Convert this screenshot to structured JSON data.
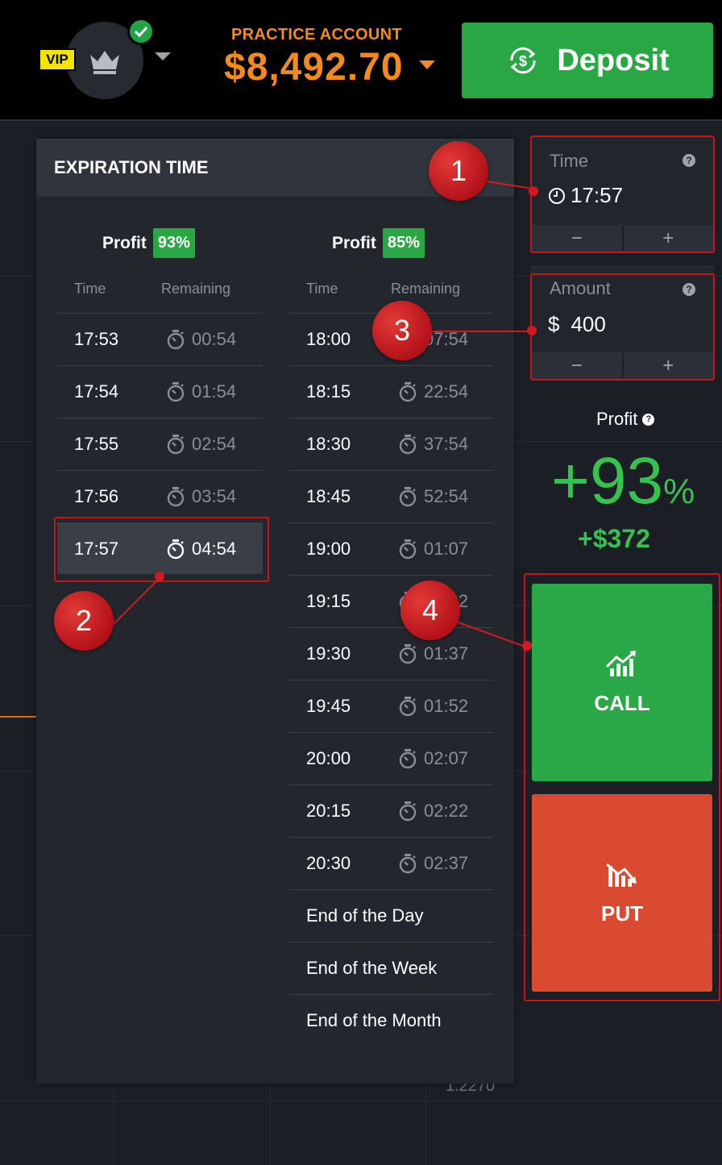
{
  "header": {
    "vip_label": "VIP",
    "account_label": "PRACTICE ACCOUNT",
    "balance": "$8,492.70",
    "deposit_label": "Deposit"
  },
  "expiration": {
    "title": "EXPIRATION TIME",
    "profit_label": "Profit",
    "col_time": "Time",
    "col_remaining": "Remaining",
    "left": {
      "profit": "93%",
      "rows": [
        {
          "time": "17:53",
          "remaining": "00:54"
        },
        {
          "time": "17:54",
          "remaining": "01:54"
        },
        {
          "time": "17:55",
          "remaining": "02:54"
        },
        {
          "time": "17:56",
          "remaining": "03:54"
        },
        {
          "time": "17:57",
          "remaining": "04:54"
        }
      ]
    },
    "right": {
      "profit": "85%",
      "rows": [
        {
          "time": "18:00",
          "remaining": "07:54"
        },
        {
          "time": "18:15",
          "remaining": "22:54"
        },
        {
          "time": "18:30",
          "remaining": "37:54"
        },
        {
          "time": "18:45",
          "remaining": "52:54"
        },
        {
          "time": "19:00",
          "remaining": "01:07"
        },
        {
          "time": "19:15",
          "remaining": "01:22"
        },
        {
          "time": "19:30",
          "remaining": "01:37"
        },
        {
          "time": "19:45",
          "remaining": "01:52"
        },
        {
          "time": "20:00",
          "remaining": "02:07"
        },
        {
          "time": "20:15",
          "remaining": "02:22"
        },
        {
          "time": "20:30",
          "remaining": "02:37"
        }
      ],
      "specials": [
        "End of the Day",
        "End of the Week",
        "End of the Month"
      ]
    }
  },
  "time_ctrl": {
    "label": "Time",
    "value": "17:57",
    "minus": "−",
    "plus": "+"
  },
  "amount_ctrl": {
    "label": "Amount",
    "currency": "$",
    "value": "400",
    "minus": "−",
    "plus": "+"
  },
  "profit": {
    "label": "Profit",
    "percent": "+93",
    "percent_sign": "%",
    "amount": "+$372"
  },
  "actions": {
    "call": "CALL",
    "put": "PUT"
  },
  "chart": {
    "price_tick": "1.2270"
  },
  "annotations": [
    "1",
    "2",
    "3",
    "4"
  ],
  "colors": {
    "accent_orange": "#f28b1c",
    "green": "#29a745",
    "red": "#d94a31",
    "annotation": "#c4151c"
  }
}
